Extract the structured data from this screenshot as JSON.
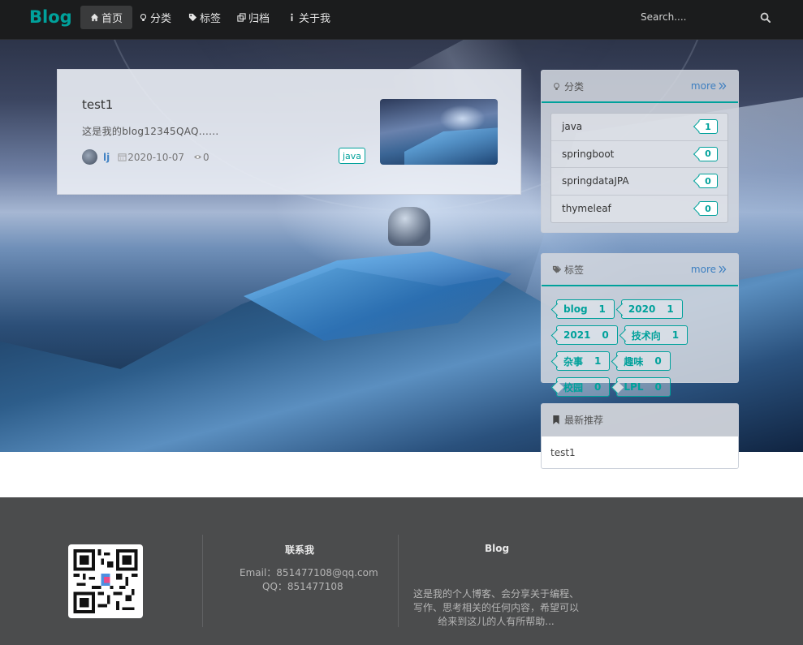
{
  "nav": {
    "brand": "Blog",
    "items": [
      {
        "label": "首页",
        "icon": "home-icon",
        "active": true
      },
      {
        "label": "分类",
        "icon": "idea-icon",
        "active": false
      },
      {
        "label": "标签",
        "icon": "tags-icon",
        "active": false
      },
      {
        "label": "归档",
        "icon": "clone-icon",
        "active": false
      },
      {
        "label": "关于我",
        "icon": "info-icon",
        "active": false
      }
    ],
    "search_placeholder": "Search...."
  },
  "blog": {
    "title": "test1",
    "excerpt": "这是我的blog12345QAQ......",
    "author": "lj",
    "date": "2020-10-07",
    "views": "0",
    "tag": "java"
  },
  "categories": {
    "title": "分类",
    "more": "more",
    "items": [
      {
        "name": "java",
        "count": "1"
      },
      {
        "name": "springboot",
        "count": "0"
      },
      {
        "name": "springdataJPA",
        "count": "0"
      },
      {
        "name": "thymeleaf",
        "count": "0"
      }
    ]
  },
  "tags": {
    "title": "标签",
    "more": "more",
    "items": [
      {
        "name": "blog",
        "count": "1"
      },
      {
        "name": "2020",
        "count": "1"
      },
      {
        "name": "2021",
        "count": "0"
      },
      {
        "name": "技术向",
        "count": "1"
      },
      {
        "name": "杂事",
        "count": "1"
      },
      {
        "name": "趣味",
        "count": "0"
      },
      {
        "name": "校园",
        "count": "0"
      },
      {
        "name": "LPL",
        "count": "0"
      }
    ]
  },
  "recommend": {
    "title": "最新推荐",
    "items": [
      "test1"
    ]
  },
  "footer": {
    "contact_title": "联系我",
    "email": "Email：851477108@qq.com",
    "qq": "QQ：851477108",
    "about_title": "Blog",
    "about_text": "这是我的个人博客、会分享关于编程、写作、思考相关的任何内容，希望可以给来到这儿的人有所帮助..."
  },
  "colors": {
    "accent": "#00a19b",
    "link": "#4183c4",
    "nav_bg": "#1b1c1d",
    "footer_bg": "#4b4c4d"
  }
}
